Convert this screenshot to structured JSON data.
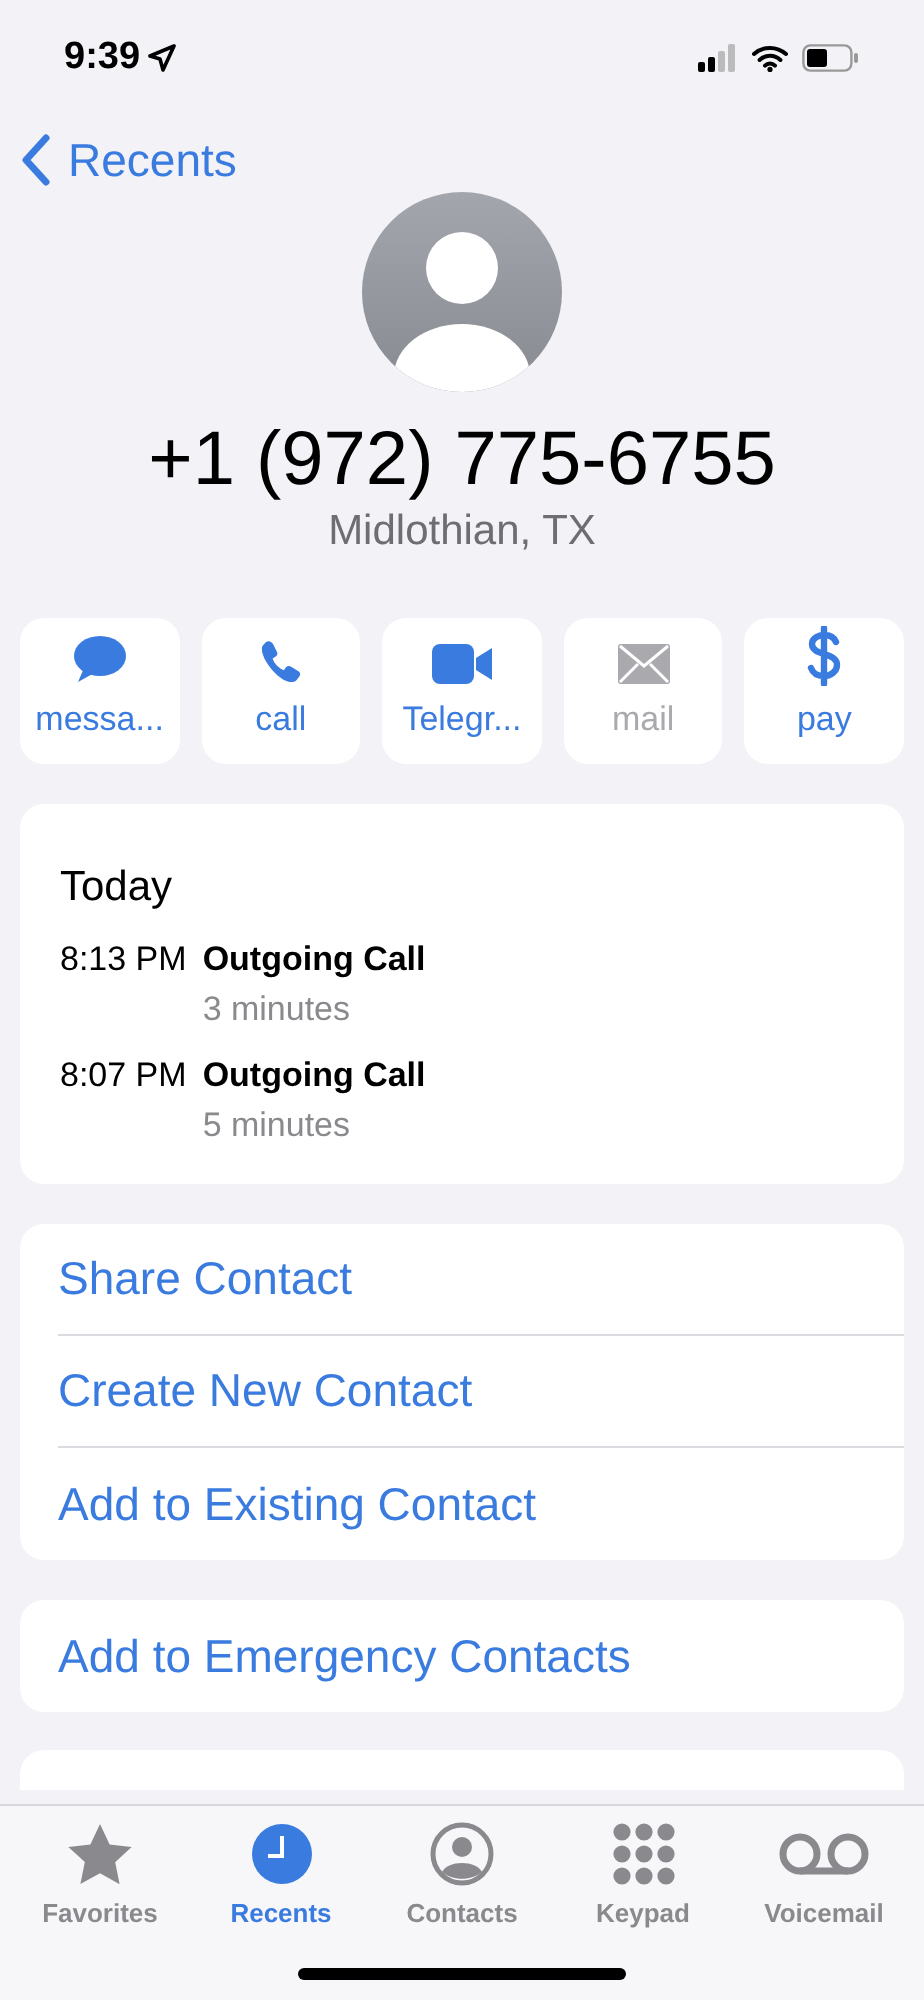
{
  "status_bar": {
    "time": "9:39"
  },
  "nav": {
    "back_label": "Recents"
  },
  "contact": {
    "number": "+1 (972) 775-6755",
    "location": "Midlothian, TX"
  },
  "actions": [
    {
      "kind": "message",
      "label": "messa...",
      "disabled": false
    },
    {
      "kind": "call",
      "label": "call",
      "disabled": false
    },
    {
      "kind": "video",
      "label": "Telegr...",
      "disabled": false
    },
    {
      "kind": "mail",
      "label": "mail",
      "disabled": true
    },
    {
      "kind": "pay",
      "label": "pay",
      "disabled": false
    }
  ],
  "history": {
    "heading": "Today",
    "entries": [
      {
        "time": "8:13 PM",
        "type": "Outgoing Call",
        "duration": "3 minutes"
      },
      {
        "time": "8:07 PM",
        "type": "Outgoing Call",
        "duration": "5 minutes"
      }
    ]
  },
  "options": [
    "Share Contact",
    "Create New Contact",
    "Add to Existing Contact"
  ],
  "emergency": "Add to Emergency Contacts",
  "tab_bar": [
    {
      "kind": "favorites",
      "label": "Favorites",
      "selected": false
    },
    {
      "kind": "recents",
      "label": "Recents",
      "selected": true
    },
    {
      "kind": "contacts",
      "label": "Contacts",
      "selected": false
    },
    {
      "kind": "keypad",
      "label": "Keypad",
      "selected": false
    },
    {
      "kind": "voicemail",
      "label": "Voicemail",
      "selected": false
    }
  ]
}
